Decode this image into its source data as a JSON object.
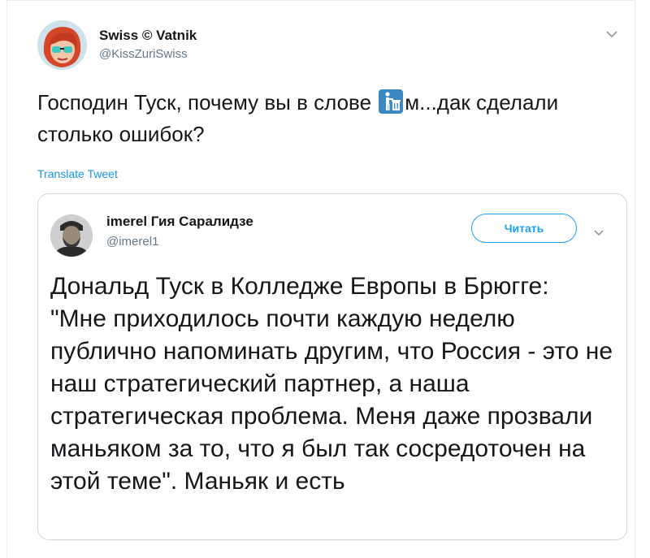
{
  "tweet": {
    "display_name": "Swiss © Vatnik",
    "username": "@KissZuriSwiss",
    "text_before_emoji": "Господин Туск, почему вы в слове ",
    "emoji_name": "litter-in-bin-sign-emoji",
    "text_after_emoji": "м...дак сделали столько ошибок?",
    "translate_label": "Translate Tweet"
  },
  "quoted": {
    "display_name": "imerel Гия Саралидзе",
    "username": "@imerel1",
    "follow_label": "Читать",
    "text": "Дональд Туск в Колледже Европы в Брюгге:\n\"Мне приходилось почти каждую неделю публично напоминать другим, что Россия - это не наш стратегический партнер, а наша стратегическая проблема. Меня даже прозвали маньяком за то, что я был так сосредоточен на этой теме\". Маньяк и есть"
  },
  "colors": {
    "link_blue": "#1b95e0",
    "brand_blue": "#1da1f2",
    "text_dark": "#14171a",
    "text_muted": "#657786",
    "border": "#ccd6dd"
  },
  "icons": [
    "avatar-image",
    "chevron-down-icon",
    "litter-in-bin-sign-emoji"
  ]
}
